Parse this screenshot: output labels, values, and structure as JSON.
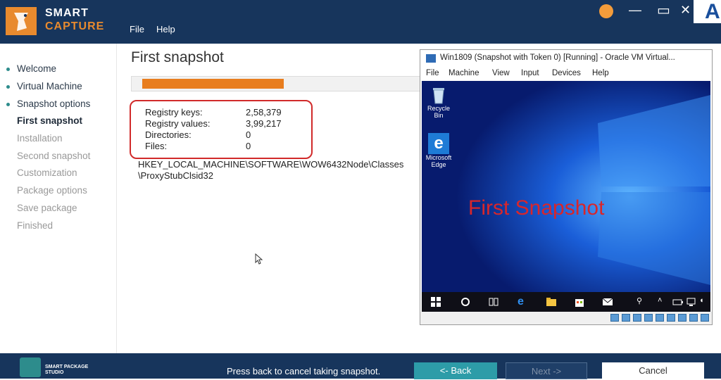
{
  "app": {
    "logo_line1": "SMART",
    "logo_line2": "CAPTURE",
    "menu": {
      "file": "File",
      "help": "Help"
    },
    "top_right_letter": "A"
  },
  "sidebar": {
    "items": [
      {
        "label": "Welcome",
        "state": "done"
      },
      {
        "label": "Virtual Machine",
        "state": "done"
      },
      {
        "label": "Snapshot options",
        "state": "done"
      },
      {
        "label": "First snapshot",
        "state": "active"
      },
      {
        "label": "Installation",
        "state": "pending"
      },
      {
        "label": "Second snapshot",
        "state": "pending"
      },
      {
        "label": "Customization",
        "state": "pending"
      },
      {
        "label": "Package options",
        "state": "pending"
      },
      {
        "label": "Save package",
        "state": "pending"
      },
      {
        "label": "Finished",
        "state": "pending"
      }
    ]
  },
  "main": {
    "title": "First snapshot",
    "progress": 0.35,
    "stats": [
      {
        "label": "Registry keys:",
        "value": "2,58,379"
      },
      {
        "label": "Registry values:",
        "value": "3,99,217"
      },
      {
        "label": "Directories:",
        "value": "0"
      },
      {
        "label": "Files:",
        "value": "0"
      }
    ],
    "current_path_line1": "HKEY_LOCAL_MACHINE\\SOFTWARE\\WOW6432Node\\Classes",
    "current_path_line2": "\\ProxyStubClsid32"
  },
  "vm": {
    "title": "Win1809 (Snapshot with Token 0) [Running] - Oracle VM Virtual...",
    "menu": [
      "File",
      "Machine",
      "View",
      "Input",
      "Devices",
      "Help"
    ],
    "desktop_icons": [
      {
        "label": "Recycle Bin",
        "icon": "recycle-bin-icon"
      },
      {
        "label": "Microsoft Edge",
        "icon": "edge-icon"
      }
    ],
    "overlay_label": "First Snapshot"
  },
  "footer": {
    "brand_line1": "SMART PACKAGE",
    "brand_line2": "STUDIO",
    "message": "Press back to cancel taking snapshot.",
    "back_label": "<- Back",
    "next_label": "Next ->",
    "cancel_label": "Cancel"
  },
  "colors": {
    "header_bg": "#17355c",
    "accent_orange": "#e87d1e",
    "accent_teal": "#2d9ca8",
    "highlight_red": "#d12a2a"
  }
}
